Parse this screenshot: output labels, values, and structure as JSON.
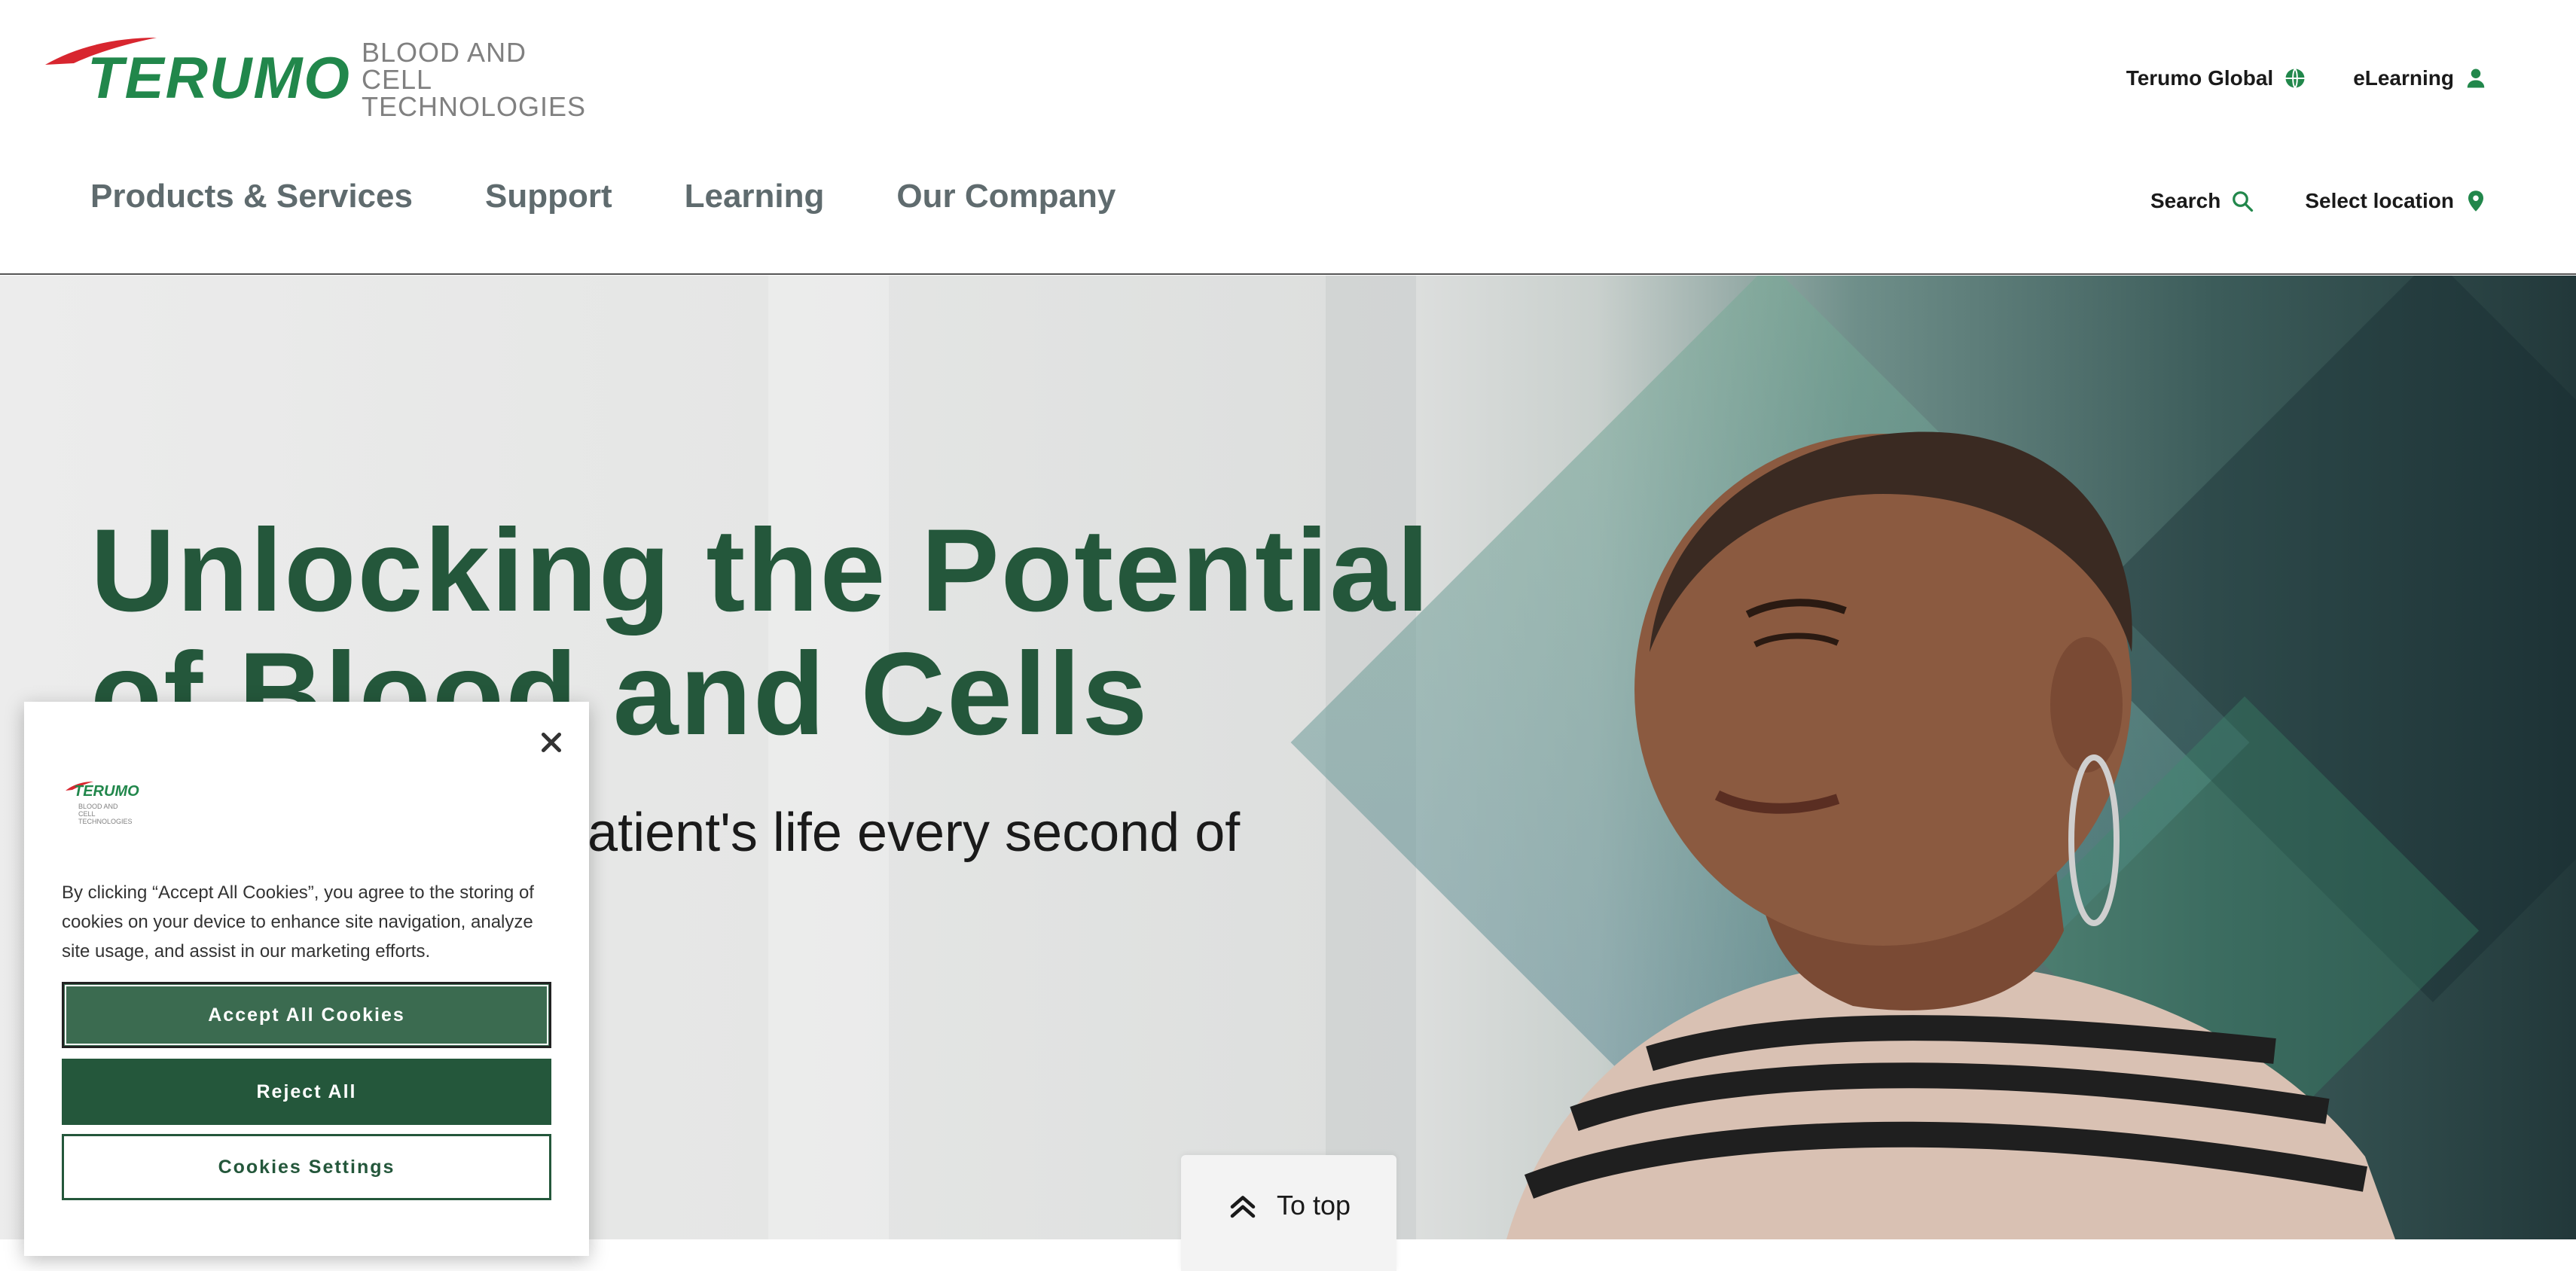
{
  "brand": {
    "logo_word": "TERUMO",
    "logo_sub_line1": "BLOOD AND CELL",
    "logo_sub_line2": "TECHNOLOGIES",
    "green": "#21874b",
    "dark_green": "#24573b",
    "red": "#d8262f"
  },
  "utility_nav": {
    "global_label": "Terumo Global",
    "global_icon": "globe-icon",
    "elearning_label": "eLearning",
    "elearning_icon": "user-icon",
    "search_label": "Search",
    "search_icon": "search-icon",
    "location_label": "Select location",
    "location_icon": "map-pin-icon"
  },
  "main_nav": {
    "items": [
      {
        "label": "Products & Services"
      },
      {
        "label": "Support"
      },
      {
        "label": "Learning"
      },
      {
        "label": "Our Company"
      }
    ]
  },
  "hero": {
    "title_line1": "Unlocking the Potential",
    "title_line2": "of Blood and Cells",
    "subtitle_visible": "patient's life every second of every"
  },
  "cookie_banner": {
    "logo_word": "TERUMO",
    "logo_sub": "BLOOD AND CELL TECHNOLOGIES",
    "text": "By clicking “Accept All Cookies”, you agree to the storing of cookies on your device to enhance site navigation, analyze site usage, and assist in our marketing efforts.",
    "accept_label": "Accept All Cookies",
    "reject_label": "Reject All",
    "settings_label": "Cookies Settings",
    "close_icon": "close-icon"
  },
  "to_top": {
    "label": "To top",
    "icon": "double-chevron-up-icon"
  }
}
